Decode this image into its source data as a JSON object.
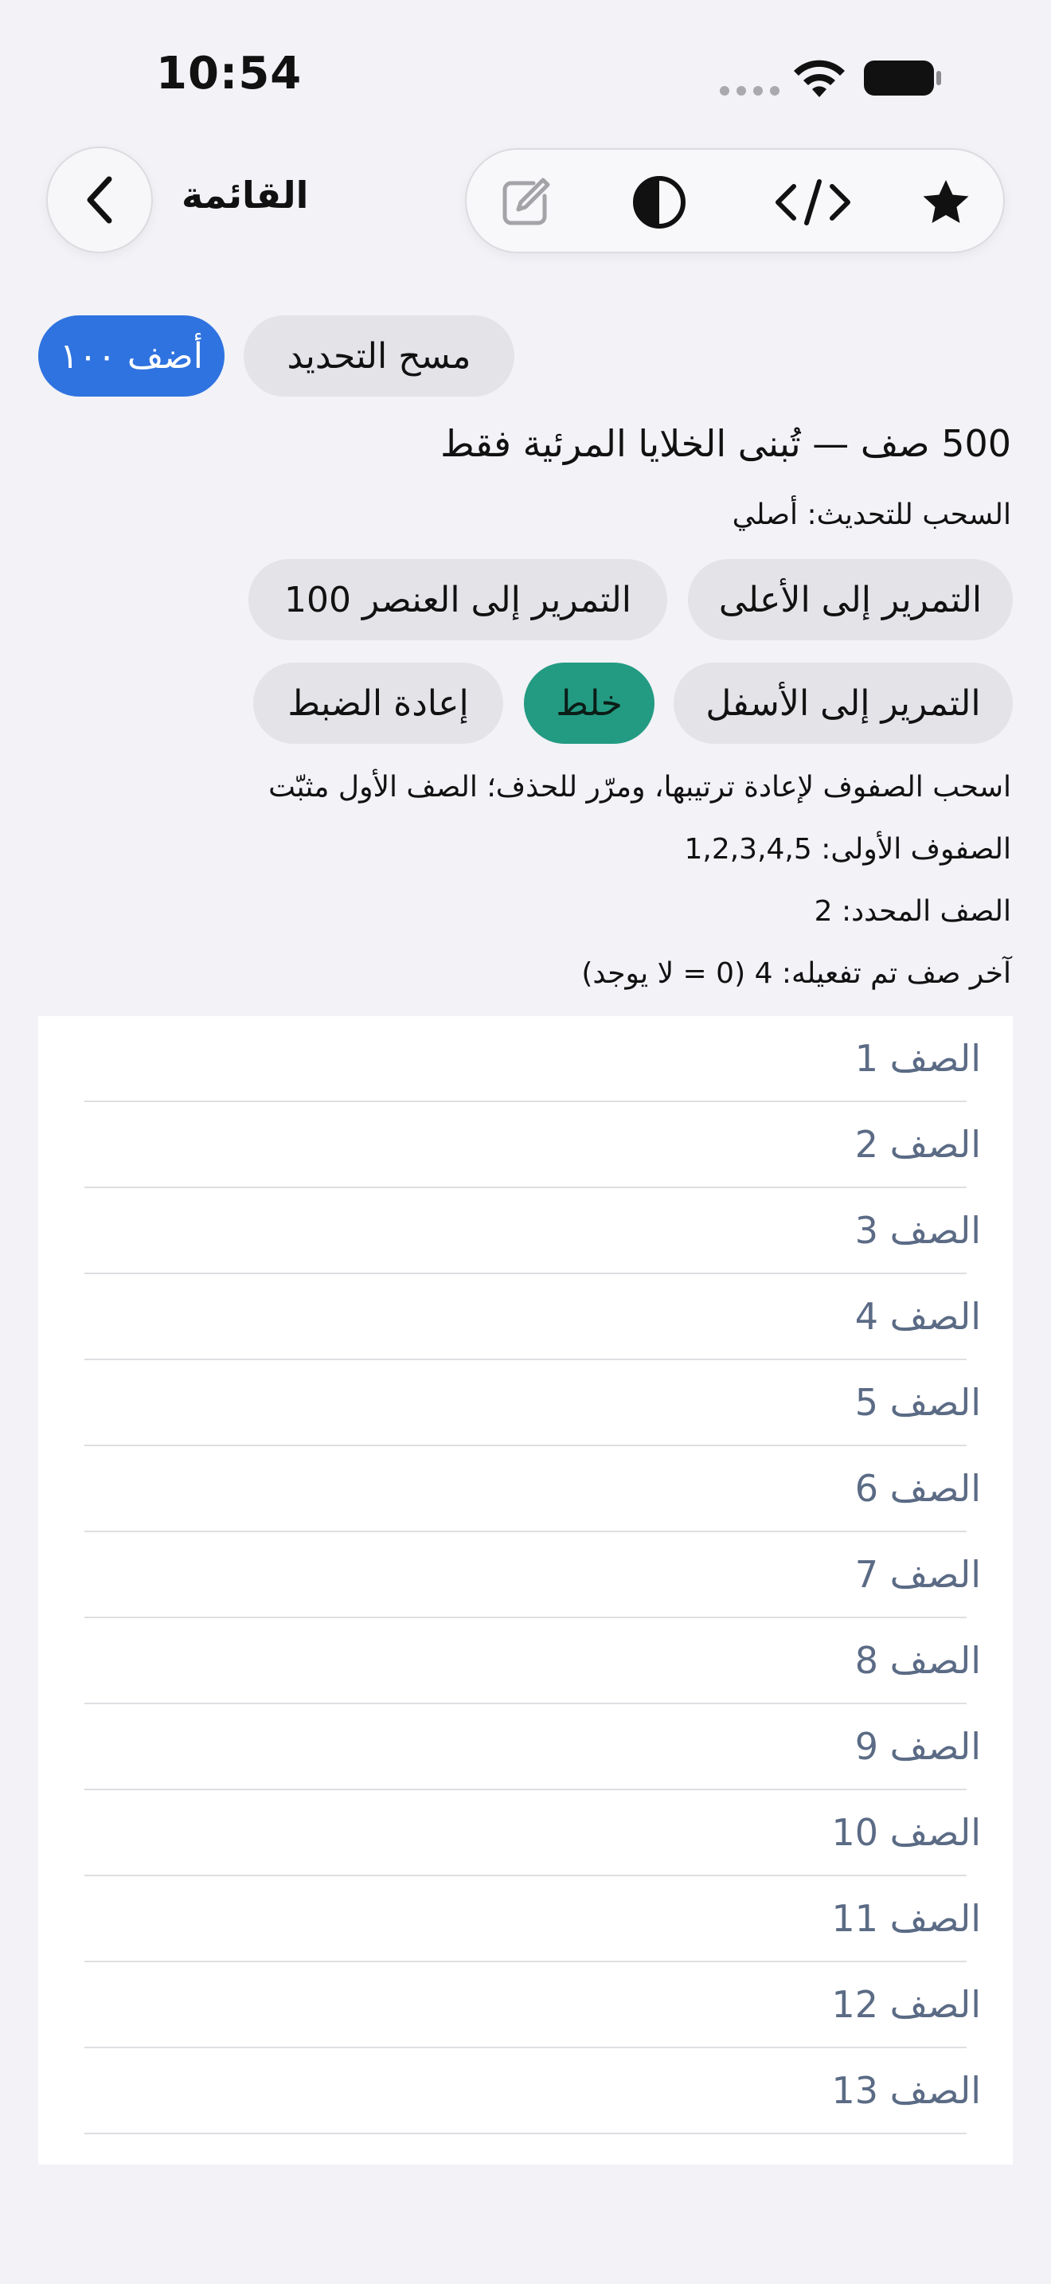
{
  "status_bar": {
    "time": "10:54"
  },
  "nav": {
    "title": "القائمة"
  },
  "buttons": {
    "add_100": "أضف ١٠٠",
    "clear_selection": "مسح التحديد",
    "scroll_top": "التمرير إلى الأعلى",
    "scroll_item_100": "التمرير إلى العنصر 100",
    "scroll_bottom": "التمرير إلى الأسفل",
    "shuffle": "خلط",
    "reset": "إعادة الضبط"
  },
  "info": {
    "headline": "500 صف — تُبنى الخلايا المرئية فقط",
    "pull_to_refresh": "السحب للتحديث: أصلي",
    "instructions": "اسحب الصفوف لإعادة ترتيبها، ومرّر للحذف؛ الصف الأول مثبّت",
    "first_rows": "الصفوف الأولى: 1,2,3,4,5",
    "selected_row": "الصف المحدد: 2",
    "last_activated": "آخر صف تم تفعيله: 4 (0 = لا يوجد)"
  },
  "rows": [
    "الصف 1",
    "الصف 2",
    "الصف 3",
    "الصف 4",
    "الصف 5",
    "الصف 6",
    "الصف 7",
    "الصف 8",
    "الصف 9",
    "الصف 10",
    "الصف 11",
    "الصف 12",
    "الصف 13"
  ],
  "icons": {
    "back": "chevron-left-icon",
    "edit": "edit-icon",
    "contrast": "contrast-icon",
    "code": "code-icon",
    "star": "star-icon"
  }
}
